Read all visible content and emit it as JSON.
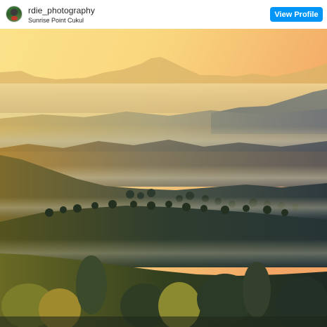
{
  "post": {
    "username": "rdie_photography",
    "location": "Sunrise Point Cukul",
    "view_profile_label": "View Profile"
  },
  "colors": {
    "button_blue": "#0095f6",
    "text_dark": "#262626"
  },
  "icons": {
    "avatar": "profile-avatar"
  }
}
